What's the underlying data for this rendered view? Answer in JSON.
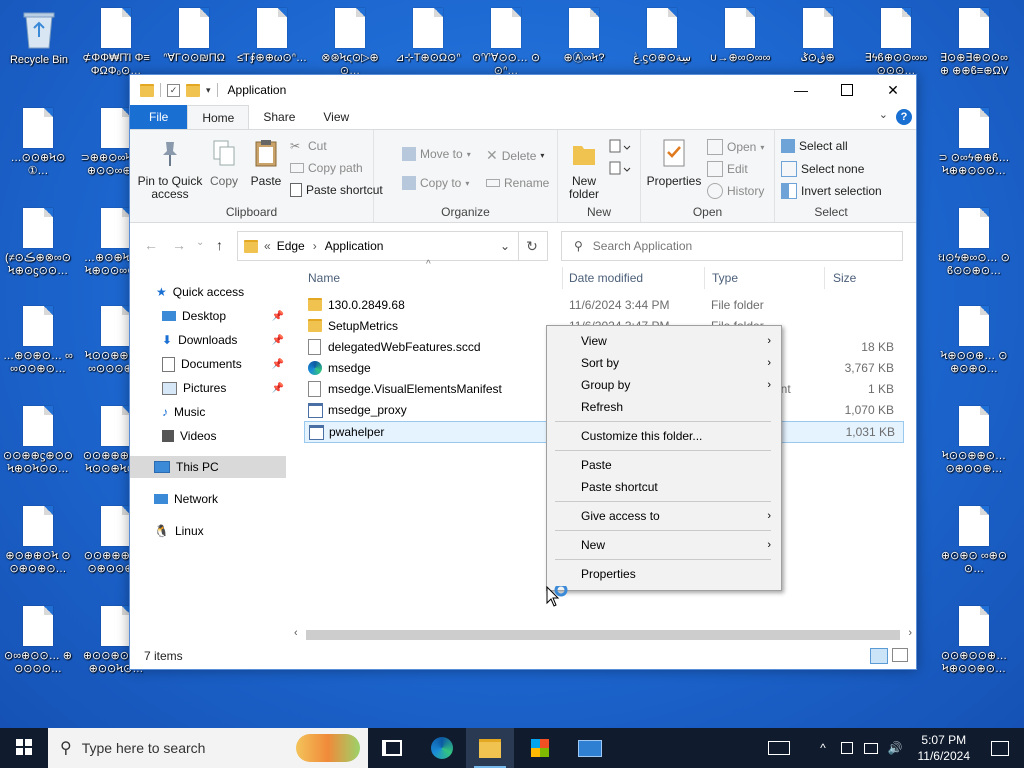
{
  "desktop": {
    "recycle_bin": "Recycle Bin",
    "icons": [
      "⊄ΦΦ₩ΠΊ Φ≡ΦΩΦ₀⊙…",
      "ᐢ∀Γ⊙⊙₪ΠΩ",
      "≤Τ∮⊕⊕ω⊙ᐢ…",
      "⊗⊛Ϟς⊙▷⊕⊙…",
      "⊿⊹Τ⊕⊙Ω⊙ᐢ",
      "⊙♈∀⊙⊙… ⊙⊙ᐢ…",
      "⊕Ⓐ∞Ϟ?",
      "ڠ.ϛ⊙⊕⊙سِة",
      "∪→⊕∞⊙∞∞",
      "ڨ⊙ݣ⊕",
      "∃ϟϐ⊕⊙⊙∞∞ ⊙⊙⊙…",
      "∃⊙⊕∃⊕⊙⊙∞⊕ ⊕⊕ϐ≡⊕ΩVX…"
    ],
    "left_icons": [
      "…⊙⊙⊕Ϟ⊙①…",
      "⊃⊕⊕⊙∞Ϟ⊕ ∃⊕⊙⊙∞⊕ι…",
      "(≠⊙ڪ⊕⊗∞⊙ Ϟ⊕⊙ϛ⊙⊙…",
      "…⊕⊙⊕Ϟ⊙⊙ Ϟ⊕⊙⊙∞⊙…",
      "…⊕⊙⊕⊙… ∞∞⊙⊙⊕⊙…",
      "Ϟ⊙⊙⊕⊕⊙⊙ ∞⊙⊙⊙⊕…",
      "⊙⊙⊕⊕ϛ⊕⊙⊙ Ϟ⊕⊙Ϟ⊙⊙…",
      "⊙⊙⊕⊕⊕⊕… Ϟ⊙⊙⊕Ϟ⊙…",
      "⊕⊙⊕⊕⊙Ϟ ⊙⊙⊕⊙⊕⊙…",
      "⊙⊙⊕⊕⊕⊙⊙ ⊙⊕⊙⊙⊕…",
      "⊙∞⊕⊙⊙… ⊕⊙⊙⊙⊙…",
      "⊕⊙⊙⊕⊙⊕… ⊕⊙⊙Ϟ⊙…"
    ],
    "right_icons": [
      "⊃ ⊙∞ϟ⊕⊕ϐ… Ϟ⊕⊕⊙⊙⊙…",
      "ઘ⊙ϟ⊕∞⊙… ⊙ϐ⊙⊙⊕⊙…",
      "Ϟ⊕⊙⊙⊕… ⊙⊕⊙⊕⊙…",
      "Ϟ⊙⊙⊕⊕⊙… ⊙⊕⊙⊙⊕…",
      "⊕⊙⊕⊙ ∞⊕⊙⊙…",
      "⊙⊙⊕⊙⊙⊕… Ϟ⊕⊙⊙⊕⊙…"
    ]
  },
  "window": {
    "title": "Application",
    "tabs": [
      "File",
      "Home",
      "Share",
      "View"
    ],
    "help": "?",
    "ribbon": {
      "clipboard": {
        "name": "Clipboard",
        "pin": "Pin to Quick access",
        "copy": "Copy",
        "paste": "Paste",
        "cut": "Cut",
        "copy_path": "Copy path",
        "paste_shortcut": "Paste shortcut"
      },
      "organize": {
        "name": "Organize",
        "move_to": "Move to",
        "copy_to": "Copy to",
        "delete": "Delete",
        "rename": "Rename"
      },
      "new": {
        "name": "New",
        "new_folder": "New folder"
      },
      "open": {
        "name": "Open",
        "properties": "Properties",
        "open": "Open",
        "edit": "Edit",
        "history": "History"
      },
      "select": {
        "name": "Select",
        "select_all": "Select all",
        "select_none": "Select none",
        "invert": "Invert selection"
      }
    },
    "address": {
      "parts": [
        "Edge",
        "Application"
      ],
      "search_placeholder": "Search Application"
    },
    "nav": {
      "quick_access": "Quick access",
      "items": [
        "Desktop",
        "Downloads",
        "Documents",
        "Pictures",
        "Music",
        "Videos"
      ],
      "this_pc": "This PC",
      "network": "Network",
      "linux": "Linux"
    },
    "columns": {
      "name": "Name",
      "date": "Date modified",
      "type": "Type",
      "size": "Size"
    },
    "files": [
      {
        "name": "130.0.2849.68",
        "date": "11/6/2024 3:44 PM",
        "type": "File folder",
        "size": ""
      },
      {
        "name": "SetupMetrics",
        "date": "11/6/2024 3:47 PM",
        "type": "File folder",
        "size": ""
      },
      {
        "name": "delegatedWebFeatures.sccd",
        "date": "",
        "type": "",
        "size": "18 KB"
      },
      {
        "name": "msedge",
        "date": "",
        "type": "",
        "size": "3,767 KB"
      },
      {
        "name": "msedge.VisualElementsManifest",
        "date": "",
        "type": "ent",
        "size": "1 KB"
      },
      {
        "name": "msedge_proxy",
        "date": "",
        "type": "",
        "size": "1,070 KB"
      },
      {
        "name": "pwahelper",
        "date": "",
        "type": "",
        "size": "1,031 KB"
      }
    ],
    "status": "7 items"
  },
  "context_menu": {
    "view": "View",
    "sort_by": "Sort by",
    "group_by": "Group by",
    "refresh": "Refresh",
    "customize": "Customize this folder...",
    "paste": "Paste",
    "paste_shortcut": "Paste shortcut",
    "give_access": "Give access to",
    "new": "New",
    "properties": "Properties"
  },
  "taskbar": {
    "search_placeholder": "Type here to search",
    "time": "5:07 PM",
    "date": "11/6/2024"
  },
  "colors": {
    "accent": "#1a6fd3",
    "desktop": "#1f6fd6",
    "taskbar": "#101c2e"
  }
}
